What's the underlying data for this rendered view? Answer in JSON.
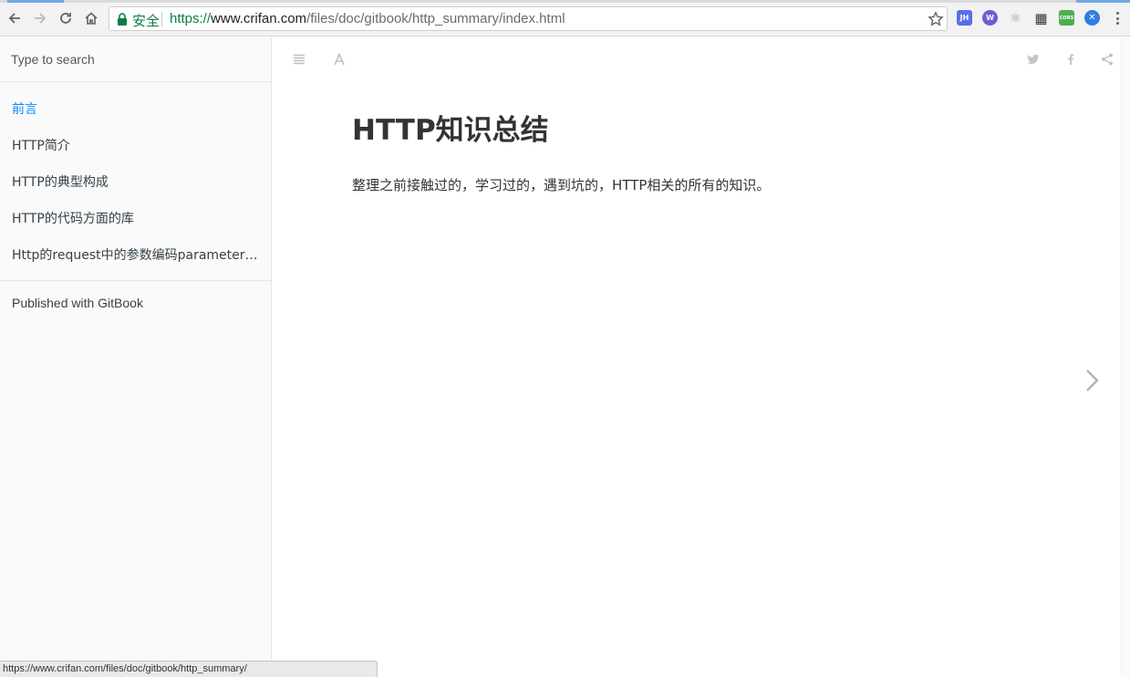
{
  "browser": {
    "security_label": "安全",
    "url_scheme": "https://",
    "url_host": "www.crifan.com",
    "url_path": "/files/doc/gitbook/http_summary/index.html",
    "extensions": [
      {
        "name": "jh-extension-icon",
        "label": "JH",
        "color": "#5a6ee8"
      },
      {
        "name": "w-extension-icon",
        "label": "W",
        "color": "#6b5ed6"
      },
      {
        "name": "react-devtools-icon",
        "label": "",
        "color": "#9aa0a6"
      },
      {
        "name": "qr-code-icon",
        "label": "",
        "color": "#333333"
      },
      {
        "name": "cors-extension-icon",
        "label": "CORS",
        "color": "#4caf50"
      },
      {
        "name": "blue-extension-icon",
        "label": "",
        "color": "#2f7ee3"
      }
    ]
  },
  "sidebar": {
    "search_placeholder": "Type to search",
    "items": [
      {
        "label": "前言",
        "active": true
      },
      {
        "label": "HTTP简介",
        "active": false
      },
      {
        "label": "HTTP的典型构成",
        "active": false
      },
      {
        "label": "HTTP的代码方面的库",
        "active": false
      },
      {
        "label": "Http的request中的参数编码parameter encoding",
        "active": false
      }
    ],
    "published": "Published with GitBook"
  },
  "content": {
    "title": "HTTP知识总结",
    "body": "整理之前接触过的，学习过的，遇到坑的，HTTP相关的所有的知识。"
  },
  "status_bar": {
    "text": "https://www.crifan.com/files/doc/gitbook/http_summary/"
  },
  "colors": {
    "accent": "#008cff",
    "secure_green": "#0b8043",
    "text": "#333333",
    "icon_gray": "#cccccc"
  }
}
